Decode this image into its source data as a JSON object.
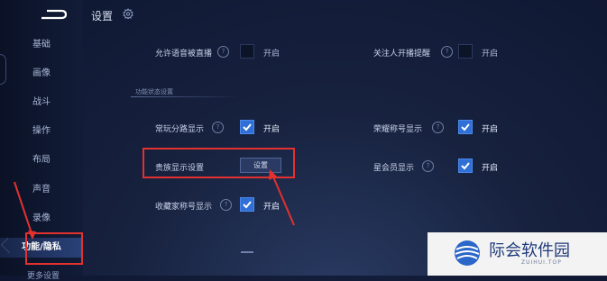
{
  "header": {
    "title": "设置"
  },
  "sidebar": {
    "items": [
      {
        "label": "基础"
      },
      {
        "label": "画像"
      },
      {
        "label": "战斗"
      },
      {
        "label": "操作"
      },
      {
        "label": "布局"
      },
      {
        "label": "声音"
      },
      {
        "label": "录像"
      },
      {
        "label": "功能/隐私"
      },
      {
        "label": "更多设置"
      }
    ],
    "active_index": 7
  },
  "rows": {
    "voice_live": {
      "label": "允许语音被直播",
      "state": "开启",
      "checked": false
    },
    "follow_live": {
      "label": "关注人开播提醒",
      "state": "开启",
      "checked": false
    },
    "section_title": "功能状态设置",
    "branch_route": {
      "label": "常玩分路显示",
      "state": "开启",
      "checked": true
    },
    "honor_title": {
      "label": "荣耀称号显示",
      "state": "开启",
      "checked": true
    },
    "noble": {
      "label": "贵族显示设置",
      "button": "设置"
    },
    "star_member": {
      "label": "星会员显示",
      "state": "开启",
      "checked": true
    },
    "collector": {
      "label": "收藏家称号显示",
      "state": "开启",
      "checked": true
    }
  },
  "watermark": {
    "name": "际会软件园",
    "url": "ZUIHUI.TOP"
  },
  "colors": {
    "accent": "#2f6fd6",
    "highlight": "#e3312f"
  }
}
